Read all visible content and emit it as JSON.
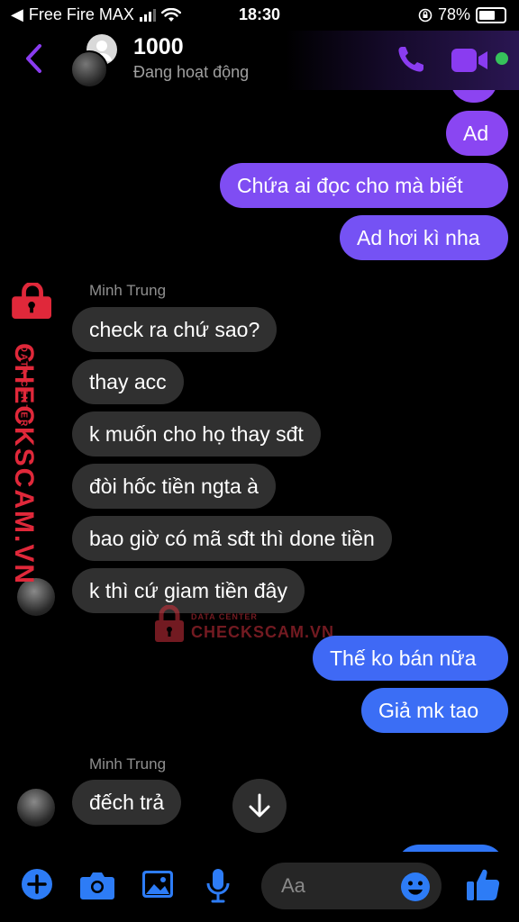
{
  "status_bar": {
    "carrier": "Free Fire MAX",
    "time": "18:30",
    "battery": "78%",
    "battery_level": 0.78
  },
  "header": {
    "contact_name": "1000",
    "status": "Đang hoạt động",
    "back_icon": "chevron-left-icon",
    "call_icon": "phone-icon",
    "video_icon": "video-camera-icon",
    "accent": "#8a3cf0"
  },
  "messages": [
    {
      "side": "out",
      "text": "Ad"
    },
    {
      "side": "out",
      "text": "Chứa ai đọc cho mà biết"
    },
    {
      "side": "out",
      "text": "Ad hơi kì nha"
    },
    {
      "side": "sender",
      "text": "Minh Trung"
    },
    {
      "side": "in",
      "text": "check ra chứ sao?"
    },
    {
      "side": "in",
      "text": "thay acc"
    },
    {
      "side": "in",
      "text": "k muốn cho họ thay sđt"
    },
    {
      "side": "in",
      "text": "đòi hốc tiền ngta à"
    },
    {
      "side": "in",
      "text": "bao giờ có mã sđt thì done tiền"
    },
    {
      "side": "in",
      "text": "k thì cứ giam tiền đây"
    },
    {
      "side": "out",
      "text": "Thế ko bán nữa"
    },
    {
      "side": "out",
      "text": "Giả mk tao"
    },
    {
      "side": "sender",
      "text": "Minh Trung"
    },
    {
      "side": "in",
      "text": "đếch trả"
    }
  ],
  "watermark": {
    "brand": "CHECKSCAM.VN",
    "tagline": "DATA CENTER"
  },
  "composer": {
    "placeholder": "Aa",
    "icons": [
      "plus-icon",
      "camera-icon",
      "image-icon",
      "microphone-icon",
      "emoji-icon",
      "thumbs-up-icon"
    ],
    "accent": "#2d7cf6"
  },
  "colors": {
    "out_top": "#9b42f2",
    "out_bottom": "#3a6ff5",
    "in_bubble": "#303030"
  }
}
